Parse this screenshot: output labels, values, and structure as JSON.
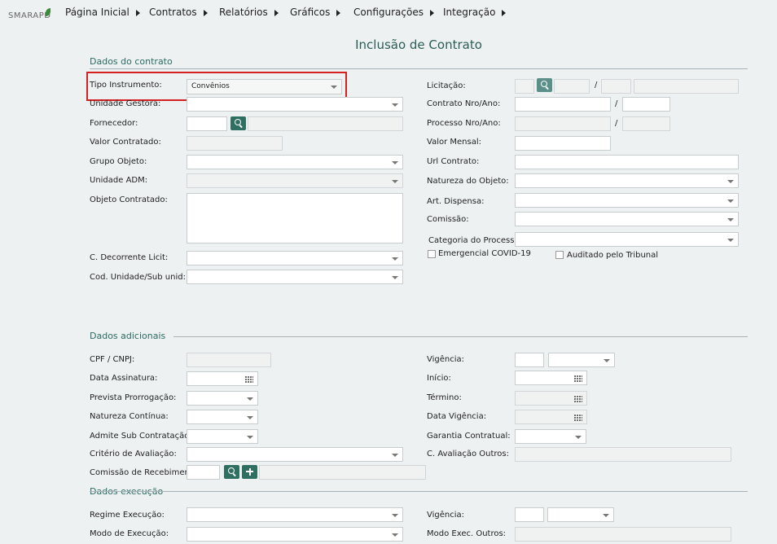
{
  "brand": "SMARAPD",
  "nav": [
    "Página Inicial",
    "Contratos",
    "Relatórios",
    "Gráficos",
    "Configurações",
    "Integração"
  ],
  "page_title": "Inclusão de Contrato",
  "sections": {
    "contrato": "Dados do contrato",
    "adicionais": "Dados adicionais",
    "execucao": "Dados execução"
  },
  "left": {
    "tipo_instrumento": {
      "label": "Tipo Instrumento:",
      "value": "Convênios"
    },
    "unidade_gestora": "Unidade Gestora:",
    "fornecedor": "Fornecedor:",
    "valor_contratado": "Valor Contratado:",
    "grupo_objeto": "Grupo Objeto:",
    "unidade_adm": "Unidade ADM:",
    "objeto_contratado": "Objeto Contratado:",
    "c_decorrente": "C. Decorrente Licit:",
    "cod_unidade": "Cod. Unidade/Sub unid:"
  },
  "right": {
    "licitacao": "Licitação:",
    "contrato_nro": "Contrato Nro/Ano:",
    "processo_nro": "Processo Nro/Ano:",
    "valor_mensal": "Valor Mensal:",
    "url_contrato": "Url Contrato:",
    "natureza_objeto": "Natureza do Objeto:",
    "art_dispensa": "Art. Dispensa:",
    "comissao": "Comissão:",
    "categoria_processo": "Categoria do Processo:",
    "emergencial": "Emergencial COVID-19",
    "auditado": "Auditado pelo Tribunal"
  },
  "adicionais": {
    "cpf": "CPF / CNPJ:",
    "data_assinatura": "Data Assinatura:",
    "prevista_prorrogacao": "Prevista Prorrogação:",
    "natureza_continua": "Natureza Contínua:",
    "admite_sub": "Admite Sub Contratação:",
    "criterio": "Critério de Avaliação:",
    "comissao_recebimento": "Comissão de Recebimento:",
    "vigencia": "Vigência:",
    "inicio": "Início:",
    "termino": "Término:",
    "data_vigencia": "Data Vigência:",
    "garantia": "Garantia Contratual:",
    "c_avaliacao_outros": "C. Avaliação Outros:"
  },
  "execucao": {
    "regime": "Regime Execução:",
    "modo": "Modo de Execução:",
    "vigencia": "Vigência:",
    "modo_outros": "Modo Exec. Outros:"
  },
  "slash": "/"
}
